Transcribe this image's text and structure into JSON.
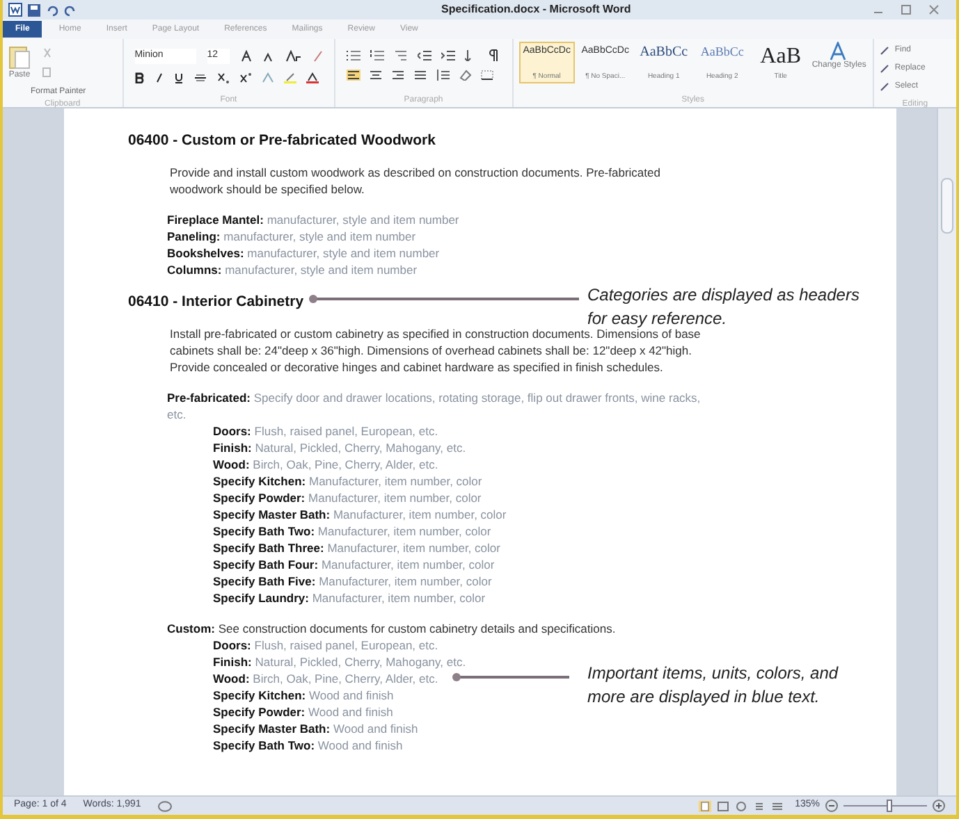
{
  "window": {
    "title": "Specification.docx - Microsoft Word"
  },
  "tabs": [
    {
      "label": "File",
      "kind": "file"
    },
    {
      "label": "Home",
      "kind": "tab"
    },
    {
      "label": "Insert",
      "kind": "tab"
    },
    {
      "label": "Page Layout",
      "kind": "tab"
    },
    {
      "label": "References",
      "kind": "tab"
    },
    {
      "label": "Mailings",
      "kind": "tab"
    },
    {
      "label": "Review",
      "kind": "tab"
    },
    {
      "label": "View",
      "kind": "tab"
    }
  ],
  "ribbon": {
    "clipboard": {
      "paste": "Paste",
      "format_painter": "Format Painter",
      "group": "Clipboard"
    },
    "font": {
      "name": "Minion",
      "size": "12",
      "group": "Font"
    },
    "paragraph": {
      "group": "Paragraph"
    },
    "styles": {
      "group": "Styles",
      "items": [
        {
          "preview": "AaBbCcDc",
          "name": "¶ Normal",
          "selected": true,
          "kind": "small"
        },
        {
          "preview": "AaBbCcDc",
          "name": "¶ No Spaci...",
          "selected": false,
          "kind": "small"
        },
        {
          "preview": "AaBbCc",
          "name": "Heading 1",
          "selected": false,
          "kind": "heading"
        },
        {
          "preview": "AaBbCc",
          "name": "Heading 2",
          "selected": false,
          "kind": "heading2"
        },
        {
          "preview": "AaB",
          "name": "Title",
          "selected": false,
          "kind": "title"
        }
      ],
      "change_styles": "Change Styles"
    },
    "editing": {
      "group": "Editing",
      "find": "Find",
      "replace": "Replace",
      "select": "Select"
    }
  },
  "document": [
    {
      "kind": "heading",
      "text": "06400 - Custom or Pre-fabricated Woodwork"
    },
    {
      "kind": "para",
      "text": " Provide and install custom woodwork as described on construction documents.  Pre-fabricated woodwork should be specified below."
    },
    {
      "kind": "spec",
      "label": "Fireplace Mantel:",
      "value": "manufacturer, style and item number"
    },
    {
      "kind": "spec",
      "label": "Paneling:",
      "value": "manufacturer, style and item number"
    },
    {
      "kind": "spec",
      "label": "Bookshelves:",
      "value": "manufacturer, style and item number"
    },
    {
      "kind": "spec",
      "label": "Columns:",
      "value": "manufacturer, style and item number"
    },
    {
      "kind": "heading",
      "text": "06410 - Interior Cabinetry"
    },
    {
      "kind": "para",
      "text": " Install pre-fabricated or custom cabinetry as specified in construction documents. Dimensions of base cabinets shall be: 24\"deep x 36\"high. Dimensions of overhead cabinets shall be: 12\"deep x 42\"high. Provide concealed or decorative hinges and cabinet hardware as specified in finish schedules."
    },
    {
      "kind": "spec",
      "label": "Pre-fabricated:",
      "value": "Specify door and drawer locations, rotating storage, flip out drawer fronts, wine racks, etc."
    },
    {
      "kind": "subspec",
      "label": "Doors:",
      "value": "Flush, raised panel, European, etc."
    },
    {
      "kind": "subspec",
      "label": "Finish:",
      "value": "Natural, Pickled, Cherry, Mahogany, etc."
    },
    {
      "kind": "subspec",
      "label": "Wood:",
      "value": "Birch, Oak, Pine, Cherry, Alder, etc."
    },
    {
      "kind": "subspec",
      "label": "Specify Kitchen:",
      "value": "Manufacturer, item number, color"
    },
    {
      "kind": "subspec",
      "label": "Specify Powder:",
      "value": "Manufacturer, item number, color"
    },
    {
      "kind": "subspec",
      "label": "Specify Master Bath:",
      "value": "Manufacturer, item number, color"
    },
    {
      "kind": "subspec",
      "label": "Specify Bath Two:",
      "value": "Manufacturer, item number, color"
    },
    {
      "kind": "subspec",
      "label": "Specify Bath Three:",
      "value": "Manufacturer, item number, color"
    },
    {
      "kind": "subspec",
      "label": "Specify Bath Four:",
      "value": "Manufacturer, item number, color"
    },
    {
      "kind": "subspec",
      "label": "Specify Bath Five:",
      "value": "Manufacturer, item number, color"
    },
    {
      "kind": "subspec",
      "label": "Specify Laundry:",
      "value": "Manufacturer, item number, color"
    },
    {
      "kind": "lead",
      "label": "Custom:",
      "value": "See construction documents for custom cabinetry details and specifications."
    },
    {
      "kind": "subspec",
      "label": "Doors:",
      "value": "Flush, raised panel, European, etc."
    },
    {
      "kind": "subspec",
      "label": "Finish:",
      "value": "Natural, Pickled, Cherry, Mahogany, etc."
    },
    {
      "kind": "subspec",
      "label": "Wood:",
      "value": "Birch, Oak, Pine, Cherry, Alder, etc."
    },
    {
      "kind": "subspec",
      "label": "Specify Kitchen:",
      "value": "Wood and finish"
    },
    {
      "kind": "subspec",
      "label": "Specify Powder:",
      "value": "Wood and finish"
    },
    {
      "kind": "subspec",
      "label": "Specify Master Bath:",
      "value": "Wood and finish"
    },
    {
      "kind": "subspec",
      "label": "Specify Bath Two:",
      "value": "Wood and finish"
    }
  ],
  "callouts": [
    "Categories are displayed as headers for easy reference.",
    "Important items, units, colors, and more are displayed in blue text."
  ],
  "status_bar": {
    "page": "Page: 1 of 4",
    "words": "Words: 1,991",
    "zoom": "135%",
    "zoom_level": {
      "level": 0.55
    }
  }
}
